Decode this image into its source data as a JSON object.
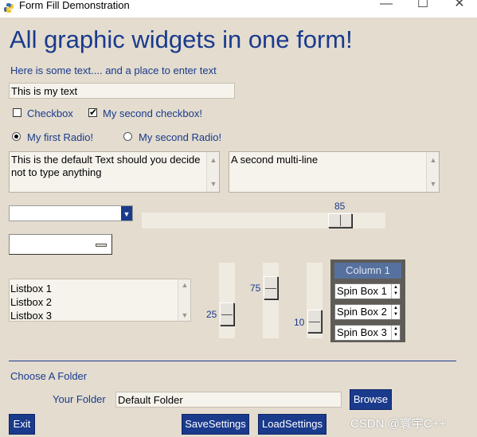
{
  "window": {
    "title": "Form Fill Demonstration",
    "minimize": "—",
    "maximize": "☐",
    "close": "✕"
  },
  "heading": "All graphic widgets in one form!",
  "intro_text": "Here is some text.... and a place to enter text",
  "text_input": {
    "value": "This is my text"
  },
  "checkboxes": [
    {
      "label": "Checkbox",
      "checked": false
    },
    {
      "label": "My second checkbox!",
      "checked": true
    }
  ],
  "radios": [
    {
      "label": "My first Radio!",
      "selected": true
    },
    {
      "label": "My second Radio!",
      "selected": false
    }
  ],
  "multiline_1": "This is the default Text should you decide not to type anything",
  "multiline_2": "A second multi-line",
  "horizontal_slider": {
    "value": "85",
    "min": 0,
    "max": 100
  },
  "listbox": {
    "items": [
      "Listbox 1",
      "Listbox 2",
      "Listbox 3"
    ]
  },
  "vertical_sliders": [
    {
      "value": "25"
    },
    {
      "value": "75"
    },
    {
      "value": "10"
    }
  ],
  "column_frame": {
    "title": "Column 1",
    "spin_boxes": [
      "Spin Box 1",
      "Spin Box 2",
      "Spin Box 3"
    ]
  },
  "folder_section": {
    "label": "Choose A Folder",
    "field_label": "Your Folder",
    "field_value": "Default Folder",
    "browse": "Browse"
  },
  "buttons": {
    "exit": "Exit",
    "save": "SaveSettings",
    "load": "LoadSettings"
  },
  "watermark": "CSDN @寰宇C++",
  "colors": {
    "accent": "#1a3a8c",
    "background": "#e3dccf",
    "frame": "#5f5c57"
  }
}
